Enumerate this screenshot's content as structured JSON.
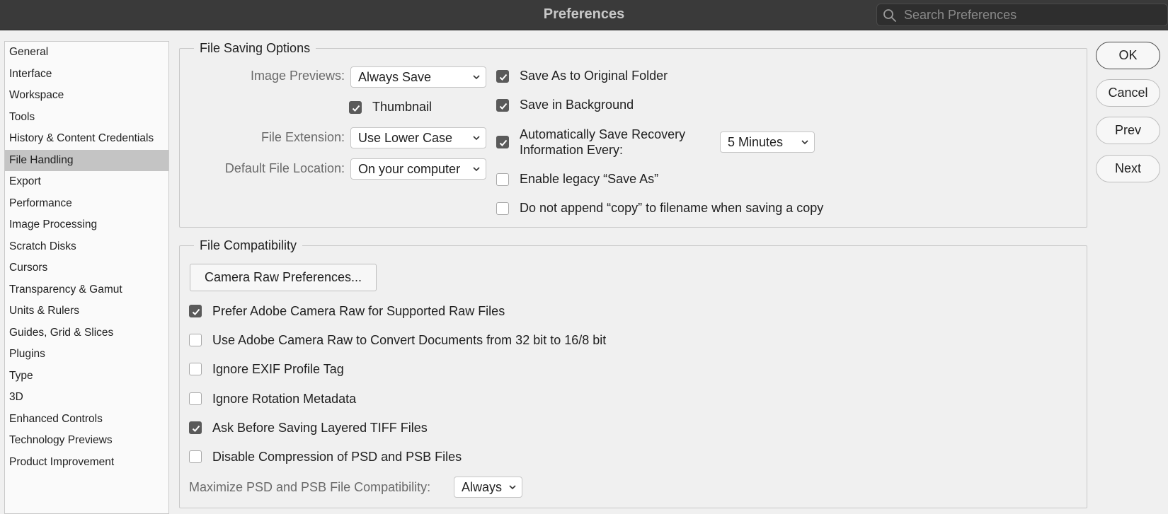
{
  "window": {
    "title": "Preferences"
  },
  "search": {
    "placeholder": "Search Preferences"
  },
  "sidebar": {
    "items": [
      "General",
      "Interface",
      "Workspace",
      "Tools",
      "History & Content Credentials",
      "File Handling",
      "Export",
      "Performance",
      "Image Processing",
      "Scratch Disks",
      "Cursors",
      "Transparency & Gamut",
      "Units & Rulers",
      "Guides, Grid & Slices",
      "Plugins",
      "Type",
      "3D",
      "Enhanced Controls",
      "Technology Previews",
      "Product Improvement"
    ],
    "selected": "File Handling"
  },
  "file_saving": {
    "legend": "File Saving Options",
    "image_previews_label": "Image Previews:",
    "image_previews_value": "Always Save",
    "thumbnail_label": "Thumbnail",
    "thumbnail_checked": true,
    "file_extension_label": "File Extension:",
    "file_extension_value": "Use Lower Case",
    "default_location_label": "Default File Location:",
    "default_location_value": "On your computer",
    "save_original_folder_label": "Save As to Original Folder",
    "save_original_folder_checked": true,
    "save_background_label": "Save in Background",
    "save_background_checked": true,
    "auto_save_label_line1": "Automatically Save Recovery",
    "auto_save_label_line2": "Information Every:",
    "auto_save_checked": true,
    "auto_save_interval": "5 Minutes",
    "legacy_save_as_label": "Enable legacy “Save As”",
    "legacy_save_as_checked": false,
    "no_copy_label": "Do not append “copy” to filename when saving a copy",
    "no_copy_checked": false
  },
  "file_compat": {
    "legend": "File Compatibility",
    "camera_raw_button": "Camera Raw Preferences...",
    "options": [
      {
        "label": "Prefer Adobe Camera Raw for Supported Raw Files",
        "checked": true
      },
      {
        "label": "Use Adobe Camera Raw to Convert Documents from 32 bit to 16/8 bit",
        "checked": false
      },
      {
        "label": "Ignore EXIF Profile Tag",
        "checked": false
      },
      {
        "label": "Ignore Rotation Metadata",
        "checked": false
      },
      {
        "label": "Ask Before Saving Layered TIFF Files",
        "checked": true
      },
      {
        "label": "Disable Compression of PSD and PSB Files",
        "checked": false
      }
    ],
    "maximize_label": "Maximize PSD and PSB File Compatibility:",
    "maximize_value": "Always"
  },
  "buttons": {
    "ok": "OK",
    "cancel": "Cancel",
    "prev": "Prev",
    "next": "Next"
  }
}
